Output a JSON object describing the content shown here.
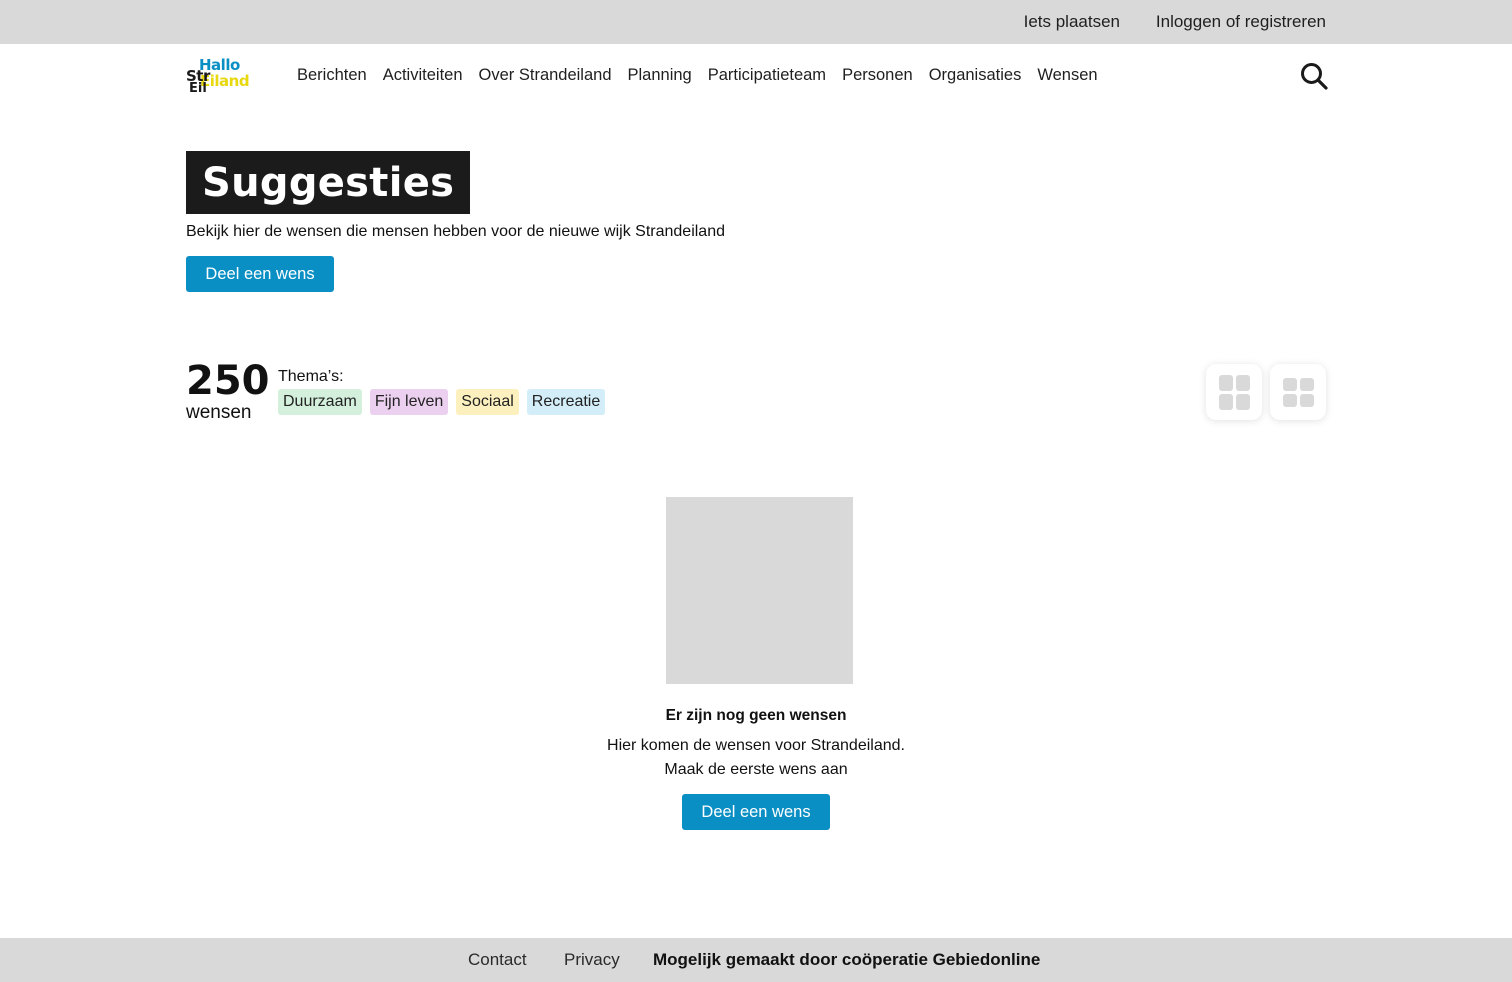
{
  "topbar": {
    "post_label": "Iets plaatsen",
    "login_label": "Inloggen of registreren"
  },
  "logo": {
    "line1": "Hallo",
    "line2": "Str",
    "line3": "Eiland",
    "line4": "Eil"
  },
  "nav": {
    "items": [
      {
        "label": "Berichten"
      },
      {
        "label": "Activiteiten"
      },
      {
        "label": "Over Strandeiland"
      },
      {
        "label": "Planning"
      },
      {
        "label": "Participatieteam"
      },
      {
        "label": "Personen"
      },
      {
        "label": "Organisaties"
      },
      {
        "label": "Wensen"
      }
    ],
    "search_icon": "search-icon"
  },
  "hero": {
    "title": "Suggesties",
    "subtitle": "Bekijk hier de wensen die mensen hebben voor de nieuwe wijk Strandeiland",
    "button_label": "Deel een wens"
  },
  "summary": {
    "count": "250",
    "count_label": "wensen",
    "themes_label": "Thema’s:",
    "themes": [
      {
        "label": "Duurzaam",
        "color": "#d4f0dc"
      },
      {
        "label": "Fijn leven",
        "color": "#ecd0f0"
      },
      {
        "label": "Sociaal",
        "color": "#fdf0bf"
      },
      {
        "label": "Recreatie",
        "color": "#d3eef9"
      }
    ],
    "view_buttons": [
      "grid-view-icon",
      "list-view-icon"
    ]
  },
  "empty_state": {
    "title": "Er zijn nog geen wensen",
    "line1": "Hier komen de wensen voor Strandeiland.",
    "line2": "Maak de eerste wens aan",
    "button_label": "Deel een wens"
  },
  "footer": {
    "contact": "Contact",
    "privacy": "Privacy",
    "credit": "Mogelijk gemaakt door coöperatie Gebiedonline"
  },
  "colors": {
    "accent": "#0a8fc4",
    "bar_gray": "#d9d9d9",
    "title_bg": "#1b1b1b"
  }
}
